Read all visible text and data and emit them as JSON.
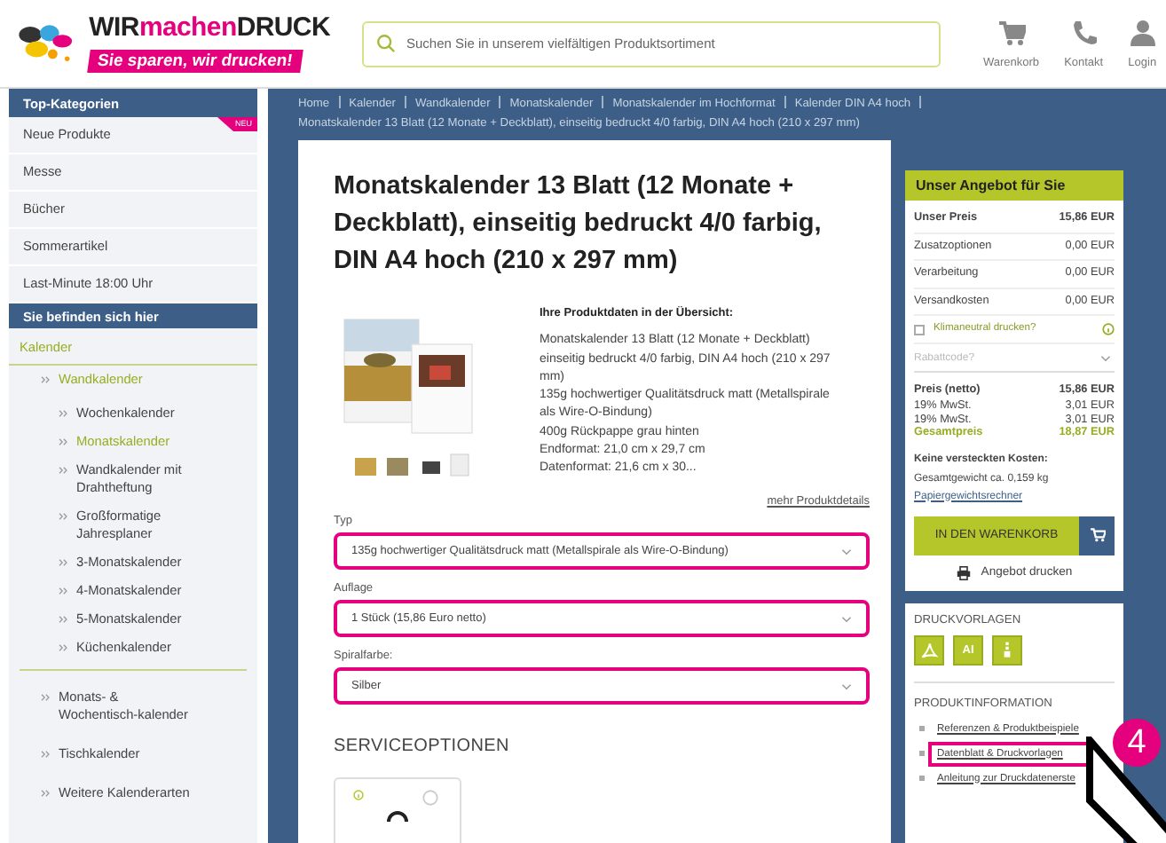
{
  "header": {
    "logo": {
      "parts": [
        "WIR",
        "machen",
        "DRUCK"
      ],
      "tagline": "Sie sparen, wir drucken!"
    },
    "search": {
      "placeholder": "Suchen Sie in unserem vielfältigen Produktsortiment"
    },
    "nav": [
      {
        "kind": "cart",
        "label": "Warenkorb"
      },
      {
        "kind": "phone",
        "label": "Kontakt"
      },
      {
        "kind": "user",
        "label": "Login"
      }
    ]
  },
  "sidebar": {
    "top_title": "Top-Kategorien",
    "top_items": [
      {
        "label": "Neue Produkte",
        "badge": "NEU"
      },
      {
        "label": "Messe"
      },
      {
        "label": "Bücher"
      },
      {
        "label": "Sommerartikel"
      },
      {
        "label": "Last-Minute 18:00 Uhr"
      }
    ],
    "here_title": "Sie befinden sich hier",
    "tree": [
      {
        "label": "Kalender",
        "active": true,
        "children": [
          {
            "label": "Wandkalender",
            "active": true,
            "children": [
              {
                "label": "Wochenkalender",
                "active": false
              },
              {
                "label": "Monatskalender",
                "active": true
              },
              {
                "label": "Wandkalender mit Drahtheftung",
                "active": false
              },
              {
                "label": "Großformatige Jahresplaner",
                "active": false
              },
              {
                "label": "3-Monatskalender",
                "active": false
              },
              {
                "label": "4-Monatskalender",
                "active": false
              },
              {
                "label": "5-Monatskalender",
                "active": false
              },
              {
                "label": "Küchenkalender",
                "active": false
              }
            ]
          },
          {
            "label": "Monats- & Wochentisch-kalender",
            "active": false
          },
          {
            "label": "Tischkalender",
            "active": false
          },
          {
            "label": "Weitere Kalenderarten",
            "active": false
          }
        ]
      }
    ]
  },
  "breadcrumbs": [
    "Home",
    "Kalender",
    "Wandkalender",
    "Monatskalender",
    "Monatskalender im Hochformat",
    "Kalender DIN A4 hoch",
    "Monatskalender 13 Blatt (12 Monate + Deckblatt), einseitig bedruckt 4/0 farbig, DIN A4 hoch (210 x 297 mm)"
  ],
  "product": {
    "title": "Monatskalender 13 Blatt (12 Monate + Deckblatt), einseitig bedruckt 4/0 farbig, DIN A4 hoch (210 x 297 mm)",
    "overview_title": "Ihre Produktdaten in der Übersicht:",
    "overview_lines": [
      "Monatskalender 13 Blatt (12 Monate + Deckblatt) einseitig bedruckt 4/0 farbig, DIN A4 hoch (210 x 297 mm)",
      "135g hochwertiger Qualitätsdruck matt (Metallspirale als Wire-O-Bindung)",
      "400g Rückpappe grau hinten",
      "Endformat: 21,0 cm x 29,7 cm",
      "Datenformat: 21,6 cm x 30..."
    ],
    "more_link": "mehr Produktdetails",
    "options": [
      {
        "label": "Typ",
        "value": "135g hochwertiger Qualitätsdruck matt (Metallspirale als Wire-O-Bindung)",
        "highlighted": true
      },
      {
        "label": "Auflage",
        "value": "1 Stück (15,86 Euro netto)",
        "highlighted": true
      },
      {
        "label": "Spiralfarbe:",
        "value": "Silber",
        "highlighted": true
      }
    ],
    "service_title": "SERVICEOPTIONEN"
  },
  "offer": {
    "title": "Unser Angebot für Sie",
    "rows": [
      {
        "label": "Unser Preis",
        "value": "15,86 EUR",
        "kind": "main"
      },
      {
        "label": "Zusatzoptionen",
        "value": "0,00 EUR",
        "kind": "plain"
      },
      {
        "label": "Verarbeitung",
        "value": "0,00 EUR",
        "kind": "plain"
      },
      {
        "label": "Versandkosten",
        "value": "0,00 EUR",
        "kind": "plain"
      }
    ],
    "climate": {
      "label": "Klimaneutral drucken?",
      "checked": false
    },
    "discount": {
      "placeholder": "Rabattcode?"
    },
    "totals": [
      {
        "label": "Preis (netto)",
        "value": "15,86 EUR",
        "kind": "net"
      },
      {
        "label": "19% MwSt.",
        "value": "3,01 EUR",
        "kind": "tax"
      },
      {
        "label": "19% MwSt.",
        "value": "3,01 EUR",
        "kind": "tax"
      },
      {
        "label": "Gesamtpreis",
        "value": "18,87 EUR",
        "kind": "total"
      }
    ],
    "notes_title": "Keine versteckten Kosten:",
    "weight": "Gesamtgewicht ca. 0,159 kg",
    "calc_link": "Papiergewichtsrechner",
    "cart_button": "IN DEN WARENKORB",
    "print": "Angebot drucken"
  },
  "templates": {
    "title": "DRUCKVORLAGEN",
    "files": [
      {
        "kind": "pdf"
      },
      {
        "kind": "ai",
        "label": "AI"
      },
      {
        "kind": "zip"
      }
    ],
    "info_title": "PRODUKTINFORMATION",
    "links": [
      {
        "label": "Referenzen & Produktbeispiele",
        "highlighted": false
      },
      {
        "label": "Datenblatt & Druckvorlagen",
        "highlighted": true
      },
      {
        "label": "Anleitung zur Druckdatenerste",
        "highlighted": false
      }
    ]
  },
  "annotation": {
    "step": "4"
  }
}
